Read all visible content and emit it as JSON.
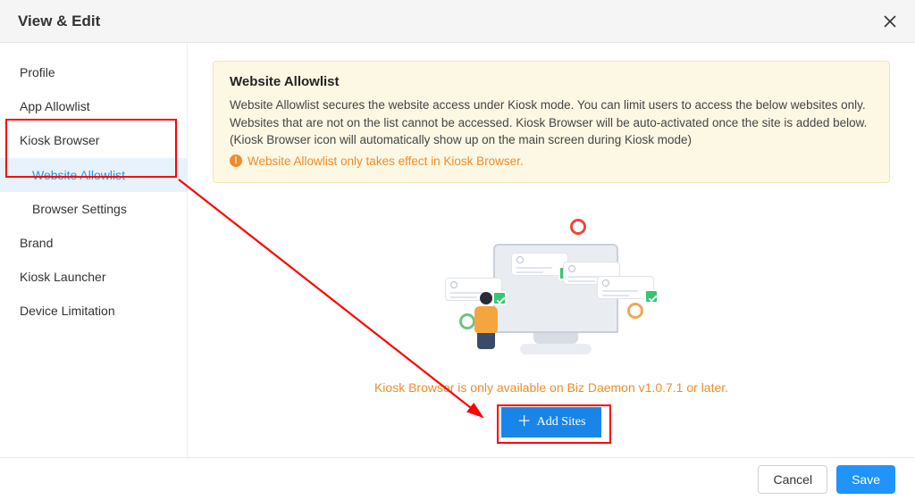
{
  "header": {
    "title": "View & Edit"
  },
  "sidebar": {
    "items": [
      {
        "label": "Profile",
        "type": "item"
      },
      {
        "label": "App Allowlist",
        "type": "item"
      },
      {
        "label": "Kiosk Browser",
        "type": "item"
      },
      {
        "label": "Website Allowlist",
        "type": "subitem",
        "active": true
      },
      {
        "label": "Browser Settings",
        "type": "subitem"
      },
      {
        "label": "Brand",
        "type": "item"
      },
      {
        "label": "Kiosk Launcher",
        "type": "item"
      },
      {
        "label": "Device Limitation",
        "type": "item"
      }
    ]
  },
  "info": {
    "title": "Website Allowlist",
    "description": "Website Allowlist secures the website access under Kiosk mode. You can limit users to access the below websites only. Websites that are not on the list cannot be accessed. Kiosk Browser will be auto-activated once the site is added below. (Kiosk Browser icon will automatically show up on the main screen during Kiosk mode)",
    "warning": "Website Allowlist only takes effect in Kiosk Browser."
  },
  "empty_state": {
    "availability_text": "Kiosk Browser is only available on Biz Daemon v1.0.7.1 or later.",
    "add_button_label": "Add Sites"
  },
  "footer": {
    "cancel_label": "Cancel",
    "save_label": "Save"
  }
}
